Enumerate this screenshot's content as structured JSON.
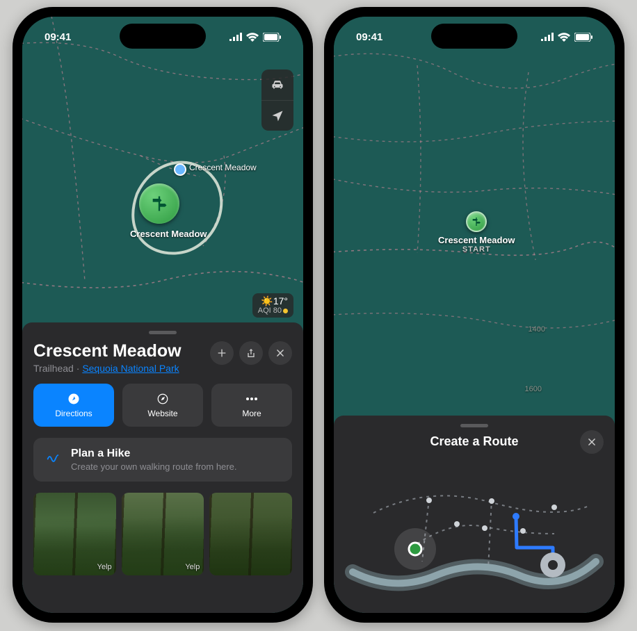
{
  "status": {
    "time": "09:41"
  },
  "map": {
    "main_label": "Crescent Meadow",
    "poi_label": "Crescent Meadow",
    "start_label": "Crescent Meadow",
    "start_sub": "START",
    "elevations": [
      "1400",
      "1600"
    ]
  },
  "weather": {
    "temp": "17°",
    "aqi_label": "AQI 80"
  },
  "place": {
    "title": "Crescent Meadow",
    "type": "Trailhead",
    "separator": " · ",
    "park_link": "Sequoia National Park"
  },
  "actions": {
    "directions": "Directions",
    "website": "Website",
    "more": "More"
  },
  "plan": {
    "title": "Plan a Hike",
    "subtitle": "Create your own walking route from here."
  },
  "photos": {
    "credit": "Yelp"
  },
  "route_sheet": {
    "title": "Create a Route"
  }
}
